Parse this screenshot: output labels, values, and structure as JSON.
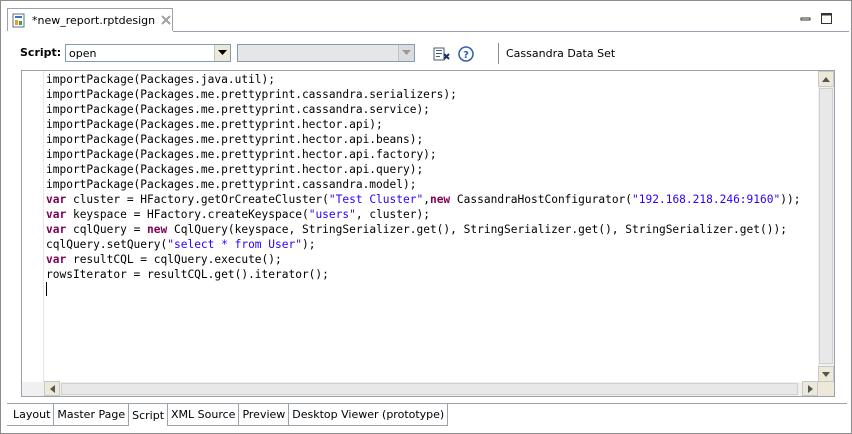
{
  "editor_tab": {
    "title": "*new_report.rptdesign"
  },
  "toolbar": {
    "script_label": "Script:",
    "method_selected": "open",
    "event_selected": "",
    "dataset_label": "Cassandra Data Set"
  },
  "code": {
    "lines": [
      [
        {
          "t": "importPackage(Packages.java.util);",
          "c": "plain"
        }
      ],
      [
        {
          "t": "importPackage(Packages.me.prettyprint.cassandra.serializers);",
          "c": "plain"
        }
      ],
      [
        {
          "t": "importPackage(Packages.me.prettyprint.cassandra.service);",
          "c": "plain"
        }
      ],
      [
        {
          "t": "importPackage(Packages.me.prettyprint.hector.api);",
          "c": "plain"
        }
      ],
      [
        {
          "t": "importPackage(Packages.me.prettyprint.hector.api.beans);",
          "c": "plain"
        }
      ],
      [
        {
          "t": "importPackage(Packages.me.prettyprint.hector.api.factory);",
          "c": "plain"
        }
      ],
      [
        {
          "t": "importPackage(Packages.me.prettyprint.hector.api.query);",
          "c": "plain"
        }
      ],
      [
        {
          "t": "importPackage(Packages.me.prettyprint.cassandra.model);",
          "c": "plain"
        }
      ],
      [
        {
          "t": "var",
          "c": "kw"
        },
        {
          "t": " cluster = HFactory.getOrCreateCluster(",
          "c": "plain"
        },
        {
          "t": "\"Test Cluster\"",
          "c": "str"
        },
        {
          "t": ",",
          "c": "plain"
        },
        {
          "t": "new",
          "c": "kw"
        },
        {
          "t": " CassandraHostConfigurator(",
          "c": "plain"
        },
        {
          "t": "\"192.168.218.246:9160\"",
          "c": "str"
        },
        {
          "t": "));",
          "c": "plain"
        }
      ],
      [
        {
          "t": "var",
          "c": "kw"
        },
        {
          "t": " keyspace = HFactory.createKeyspace(",
          "c": "plain"
        },
        {
          "t": "\"users\"",
          "c": "str"
        },
        {
          "t": ", cluster);",
          "c": "plain"
        }
      ],
      [
        {
          "t": "var",
          "c": "kw"
        },
        {
          "t": " cqlQuery = ",
          "c": "plain"
        },
        {
          "t": "new",
          "c": "kw"
        },
        {
          "t": " CqlQuery(keyspace, StringSerializer.get(), StringSerializer.get(), StringSerializer.get());",
          "c": "plain"
        }
      ],
      [
        {
          "t": "cqlQuery.setQuery(",
          "c": "plain"
        },
        {
          "t": "\"select * from User\"",
          "c": "str"
        },
        {
          "t": ");",
          "c": "plain"
        }
      ],
      [
        {
          "t": "var",
          "c": "kw"
        },
        {
          "t": " resultCQL = cqlQuery.execute();",
          "c": "plain"
        }
      ],
      [
        {
          "t": "rowsIterator = resultCQL.get().iterator();",
          "c": "plain"
        }
      ]
    ]
  },
  "page_tabs": [
    {
      "label": "Layout",
      "active": false
    },
    {
      "label": "Master Page",
      "active": false
    },
    {
      "label": "Script",
      "active": true
    },
    {
      "label": "XML Source",
      "active": false
    },
    {
      "label": "Preview",
      "active": false
    },
    {
      "label": "Desktop Viewer (prototype)",
      "active": false
    }
  ],
  "colors": {
    "keyword": "#7f0055",
    "string": "#2a00ff",
    "border": "#9aa3ad"
  },
  "icons": [
    "report-file-icon",
    "close-icon",
    "minimize-icon",
    "maximize-icon",
    "chevron-down-icon",
    "insert-expression-icon",
    "help-icon"
  ]
}
